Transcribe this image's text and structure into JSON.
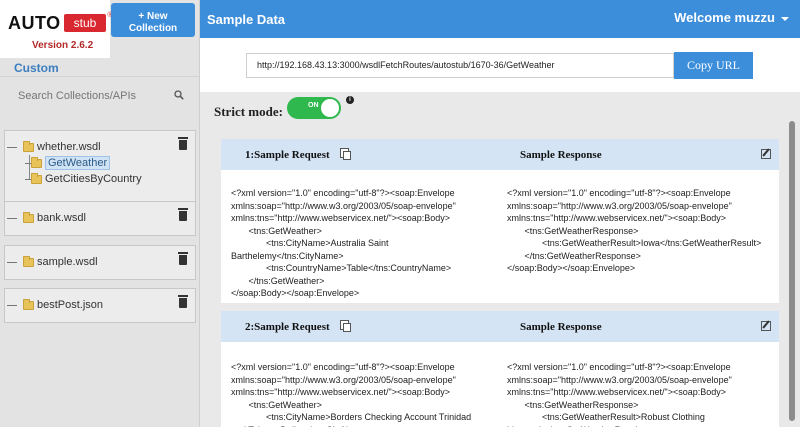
{
  "app": {
    "logo_main": "AUTO",
    "logo_sub": "stub",
    "logo_reg": "®",
    "version": "Version 2.6.2",
    "new_collection_line1": "+ New",
    "new_collection_line2": "Collection"
  },
  "sidebar": {
    "section_label": "Custom",
    "search_placeholder": "Search Collections/APIs",
    "collections": [
      {
        "name": "whether.wsdl",
        "children": [
          {
            "name": "GetWeather",
            "selected": true
          },
          {
            "name": "GetCitiesByCountry",
            "selected": false
          }
        ]
      },
      {
        "name": "bank.wsdl",
        "children": []
      },
      {
        "name": "sample.wsdl",
        "children": []
      },
      {
        "name": "bestPost.json",
        "children": []
      }
    ]
  },
  "header": {
    "title": "Sample Data",
    "welcome": "Welcome muzzu"
  },
  "url_bar": {
    "url": "http://192.168.43.13:3000/wsdlFetchRoutes/autostub/1670-36/GetWeather",
    "copy_label": "Copy URL"
  },
  "strict_mode": {
    "label": "Strict mode:",
    "state": "ON",
    "info": "i"
  },
  "samples": [
    {
      "request_title": "1:Sample Request",
      "response_title": "Sample Response",
      "request": "<?xml version=\"1.0\" encoding=\"utf-8\"?><soap:Envelope\nxmlns:soap=\"http://www.w3.org/2003/05/soap-envelope\"\nxmlns:tns=\"http://www.webservicex.net/\"><soap:Body>\n       <tns:GetWeather>\n              <tns:CityName>Australia Saint\nBarthelemy</tns:CityName>\n              <tns:CountryName>Table</tns:CountryName>\n       </tns:GetWeather>\n</soap:Body></soap:Envelope>",
      "response": "<?xml version=\"1.0\" encoding=\"utf-8\"?><soap:Envelope\nxmlns:soap=\"http://www.w3.org/2003/05/soap-envelope\"\nxmlns:tns=\"http://www.webservicex.net/\"><soap:Body>\n       <tns:GetWeatherResponse>\n              <tns:GetWeatherResult>Iowa</tns:GetWeatherResult>\n       </tns:GetWeatherResponse>\n</soap:Body></soap:Envelope>"
    },
    {
      "request_title": "2:Sample Request",
      "response_title": "Sample Response",
      "request": "<?xml version=\"1.0\" encoding=\"utf-8\"?><soap:Envelope\nxmlns:soap=\"http://www.w3.org/2003/05/soap-envelope\"\nxmlns:tns=\"http://www.webservicex.net/\"><soap:Body>\n       <tns:GetWeather>\n              <tns:CityName>Borders Checking Account Trinidad\nand Tobago Dollar</tns:CityName>",
      "response": "<?xml version=\"1.0\" encoding=\"utf-8\"?><soap:Envelope\nxmlns:soap=\"http://www.w3.org/2003/05/soap-envelope\"\nxmlns:tns=\"http://www.webservicex.net/\"><soap:Body>\n       <tns:GetWeatherResponse>\n              <tns:GetWeatherResult>Robust Clothing\nbluetooth</tns:GetWeatherResult>"
    }
  ],
  "colors": {
    "primary": "#3c8edb",
    "toggle_on": "#2fb84d",
    "card_header": "#d4e4f5",
    "brand_red": "#d9282f"
  }
}
